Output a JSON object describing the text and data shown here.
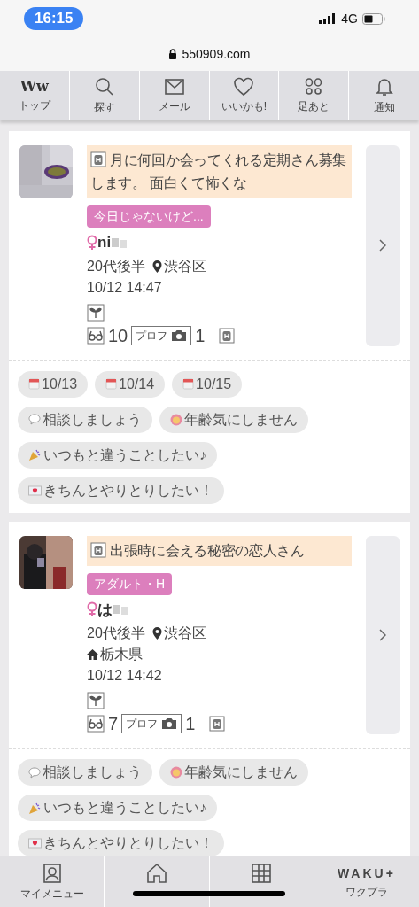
{
  "status_bar": {
    "time": "16:15",
    "network": "4G"
  },
  "address_bar": {
    "url": "550909.com"
  },
  "top_nav": [
    {
      "kind": "logo",
      "logo_text": "Ww",
      "label": "トップ"
    },
    {
      "kind": "search",
      "label": "探す"
    },
    {
      "kind": "mail",
      "label": "メール"
    },
    {
      "kind": "heart",
      "label": "いいかも!"
    },
    {
      "kind": "footprints",
      "label": "足あと"
    },
    {
      "kind": "bell",
      "label": "通知"
    }
  ],
  "posts": [
    {
      "title": "月に何回か会ってくれる定期さん募集します。 面白くて怖くな",
      "tag": "今日じゃないけど...",
      "name": "ni",
      "age": "20代後半",
      "area": "渋谷区",
      "time": "10/12 14:47",
      "views": "10",
      "photo_label": "プロフ",
      "photos": "1",
      "chips": [
        [
          {
            "kind": "calendar",
            "label": "10/13"
          },
          {
            "kind": "calendar",
            "label": "10/14"
          },
          {
            "kind": "calendar",
            "label": "10/15"
          }
        ],
        [
          {
            "kind": "speech",
            "label": "相談しましょう"
          },
          {
            "kind": "face",
            "label": "年齢気にしません"
          }
        ],
        [
          {
            "kind": "party",
            "label": "いつもと違うことしたい♪"
          }
        ],
        [
          {
            "kind": "letter",
            "label": "きちんとやりとりしたい！"
          }
        ]
      ]
    },
    {
      "title": "出張時に会える秘密の恋人さん",
      "tag": "アダルト・H",
      "name": "は",
      "age": "20代後半",
      "area": "渋谷区",
      "home": "栃木県",
      "time": "10/12 14:42",
      "views": "7",
      "photo_label": "プロフ",
      "photos": "1",
      "chips": [
        [
          {
            "kind": "speech",
            "label": "相談しましょう"
          },
          {
            "kind": "face",
            "label": "年齢気にしません"
          }
        ],
        [
          {
            "kind": "party",
            "label": "いつもと違うことしたい♪"
          }
        ],
        [
          {
            "kind": "letter",
            "label": "きちんとやりとりしたい！"
          }
        ]
      ]
    }
  ],
  "bottom_nav": [
    {
      "kind": "person",
      "label": "マイメニュー"
    },
    {
      "kind": "house"
    },
    {
      "kind": "grid"
    },
    {
      "kind": "logo",
      "logo_text": "WAKU+",
      "label": "ワクプラ"
    }
  ]
}
